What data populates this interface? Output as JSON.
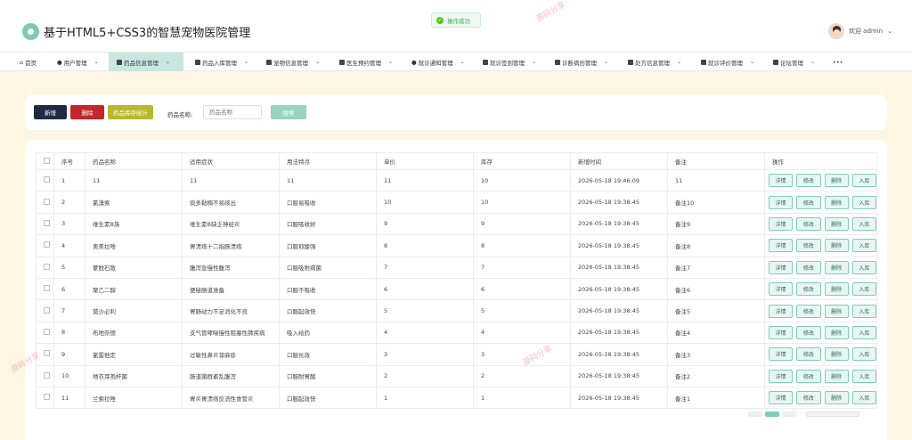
{
  "header": {
    "title": "基于HTML5+CSS3的智慧宠物医院管理",
    "user_label": "欢迎 admin"
  },
  "toast": {
    "text": "操作成功"
  },
  "nav": {
    "items": [
      {
        "label": "首页",
        "icon": "home-icon"
      },
      {
        "label": "用户管理",
        "icon": "user-icon"
      },
      {
        "label": "药品信息管理",
        "icon": "medicine-icon"
      },
      {
        "label": "药品入库管理",
        "icon": "grid-icon"
      },
      {
        "label": "宠物信息管理",
        "icon": "grid-icon"
      },
      {
        "label": "医生预约管理",
        "icon": "grid-icon"
      },
      {
        "label": "就诊通知管理",
        "icon": "bell-icon"
      },
      {
        "label": "就诊签到管理",
        "icon": "checkin-icon"
      },
      {
        "label": "诊断病历管理",
        "icon": "record-icon"
      },
      {
        "label": "处方信息管理",
        "icon": "prescription-icon"
      },
      {
        "label": "就诊评价管理",
        "icon": "grid-icon"
      },
      {
        "label": "论坛管理",
        "icon": "forum-icon"
      },
      {
        "label": "•••",
        "icon": "more-icon"
      }
    ],
    "active": "药品信息管理"
  },
  "toolbar": {
    "add_label": "新增",
    "delete_label": "删除",
    "stock_label": "药品库存统计",
    "search_label": "药品名称:",
    "search_placeholder": "药品名称",
    "search_button": "搜索"
  },
  "table": {
    "headers": [
      "序号",
      "药品名称",
      "适用症状",
      "用法特点",
      "单价",
      "库存",
      "新增时间",
      "备注",
      "操作"
    ],
    "actions": [
      "详情",
      "修改",
      "删除",
      "入库"
    ],
    "rows": [
      [
        "1",
        "11",
        "11",
        "11",
        "11",
        "10",
        "2026-05-18 19:46:09",
        "11"
      ],
      [
        "2",
        "氯溴索",
        "痰多黏稠不易咳出",
        "口服易吸收",
        "10",
        "10",
        "2026-05-18 19:38:45",
        "备注10"
      ],
      [
        "3",
        "维生素B族",
        "维生素B缺乏神经炎",
        "口服吸收好",
        "9",
        "9",
        "2026-05-18 19:38:45",
        "备注9"
      ],
      [
        "4",
        "奥美拉唑",
        "胃溃疡十二指肠溃疡",
        "口服抑酸强",
        "8",
        "8",
        "2026-05-18 19:38:45",
        "备注8"
      ],
      [
        "5",
        "蒙脱石散",
        "腹泻急慢性腹泻",
        "口服吸附病菌",
        "7",
        "7",
        "2026-05-18 19:38:45",
        "备注7"
      ],
      [
        "6",
        "聚乙二醇",
        "便秘肠道准备",
        "口服不吸收",
        "6",
        "6",
        "2026-05-18 19:38:45",
        "备注6"
      ],
      [
        "7",
        "莫沙必利",
        "胃肠动力不足消化不良",
        "口服起效快",
        "5",
        "5",
        "2026-05-18 19:38:45",
        "备注5"
      ],
      [
        "8",
        "布地奈德",
        "支气管哮喘慢性阻塞性肺疾病",
        "吸入给药",
        "4",
        "4",
        "2026-05-18 19:38:45",
        "备注4"
      ],
      [
        "9",
        "氯雷他定",
        "过敏性鼻炎荨麻疹",
        "口服长效",
        "3",
        "3",
        "2026-05-18 19:38:45",
        "备注3"
      ],
      [
        "10",
        "地衣芽孢杆菌",
        "肠道菌群紊乱腹泻",
        "口服耐胃酸",
        "2",
        "2",
        "2026-05-18 19:38:45",
        "备注2"
      ],
      [
        "11",
        "兰索拉唑",
        "胃炎胃溃疡反流性食管炎",
        "口服起效快",
        "1",
        "1",
        "2026-05-18 19:38:45",
        "备注1"
      ]
    ]
  },
  "watermarks": [
    "源码分享",
    "源码分享",
    "源码分享"
  ],
  "colors": {
    "accent": "#7dc9b6",
    "nav_active": "#c9e7e0",
    "add": "#1f2a44",
    "delete": "#c1272d",
    "stock": "#b7b82e",
    "background": "#fdf6e3"
  }
}
